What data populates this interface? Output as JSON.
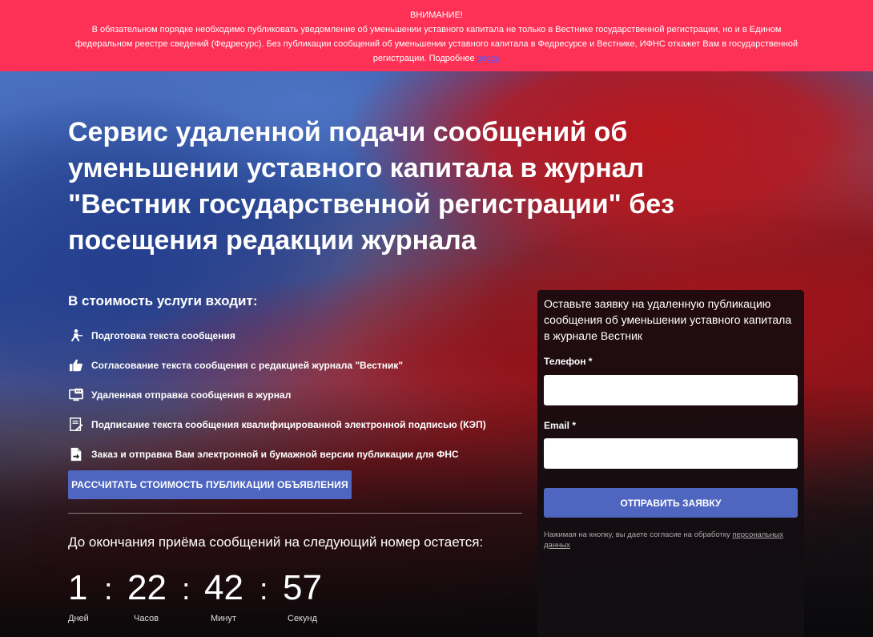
{
  "alert": {
    "title": "ВНИМАНИЕ!",
    "text": "В обязательном порядке необходимо публиковать уведомление об уменьшении уставного капитала не только в Вестнике государственной регистрации, но и в Едином федеральном реестре сведений (Федресурс). Без публикации сообщений об уменьшении уставного капитала в Федресурсе и Вестнике, ИФНС откажет Вам в государственной регистрации. Подробнее ",
    "link": "здесь",
    "bg_color": "#fc3155"
  },
  "hero": {
    "headline": "Сервис удаленной подачи сообщений об уменьшении уставного капитала в журнал \"Вестник государственной регистрации\" без посещения редакции журнала"
  },
  "included": {
    "title": "В стоимость услуги входит:",
    "items": [
      {
        "icon": "typist-icon",
        "label": "Подготовка текста сообщения"
      },
      {
        "icon": "thumbs-up-icon",
        "label": "Согласование текста сообщения с редакцией журнала \"Вестник\""
      },
      {
        "icon": "monitor-chat-icon",
        "label": "Удаленная отправка сообщения в журнал"
      },
      {
        "icon": "signature-icon",
        "label": "Подписание текста сообщения квалифицированной электронной подписью (КЭП)"
      },
      {
        "icon": "file-export-icon",
        "label": "Заказ и отправка Вам электронной и бумажной версии публикации для ФНС"
      }
    ],
    "button": "РАССЧИТАТЬ СТОИМОСТЬ ПУБЛИКАЦИИ ОБЪЯВЛЕНИЯ"
  },
  "countdown": {
    "caption": "До окончания приёма сообщений на следующий номер остается:",
    "days": "1",
    "hours": "22",
    "minutes": "42",
    "seconds": "57",
    "separator": ":",
    "days_label": "Дней",
    "hours_label": "Часов",
    "minutes_label": "Минут",
    "seconds_label": "Секунд"
  },
  "form": {
    "title": "Оставьте заявку на удаленную публикацию сообщения об уменьшении уставного капитала в журнале Вестник",
    "phone_label": "Телефон *",
    "phone_value": "",
    "email_label": "Email *",
    "email_value": "",
    "submit": "ОТПРАВИТЬ ЗАЯВКУ",
    "consent_text": "Нажимая на кнопку, вы даете согласие на обработку ",
    "consent_link": "персональных данных"
  },
  "colors": {
    "accent": "#4e66c0",
    "alert": "#fc3155"
  }
}
